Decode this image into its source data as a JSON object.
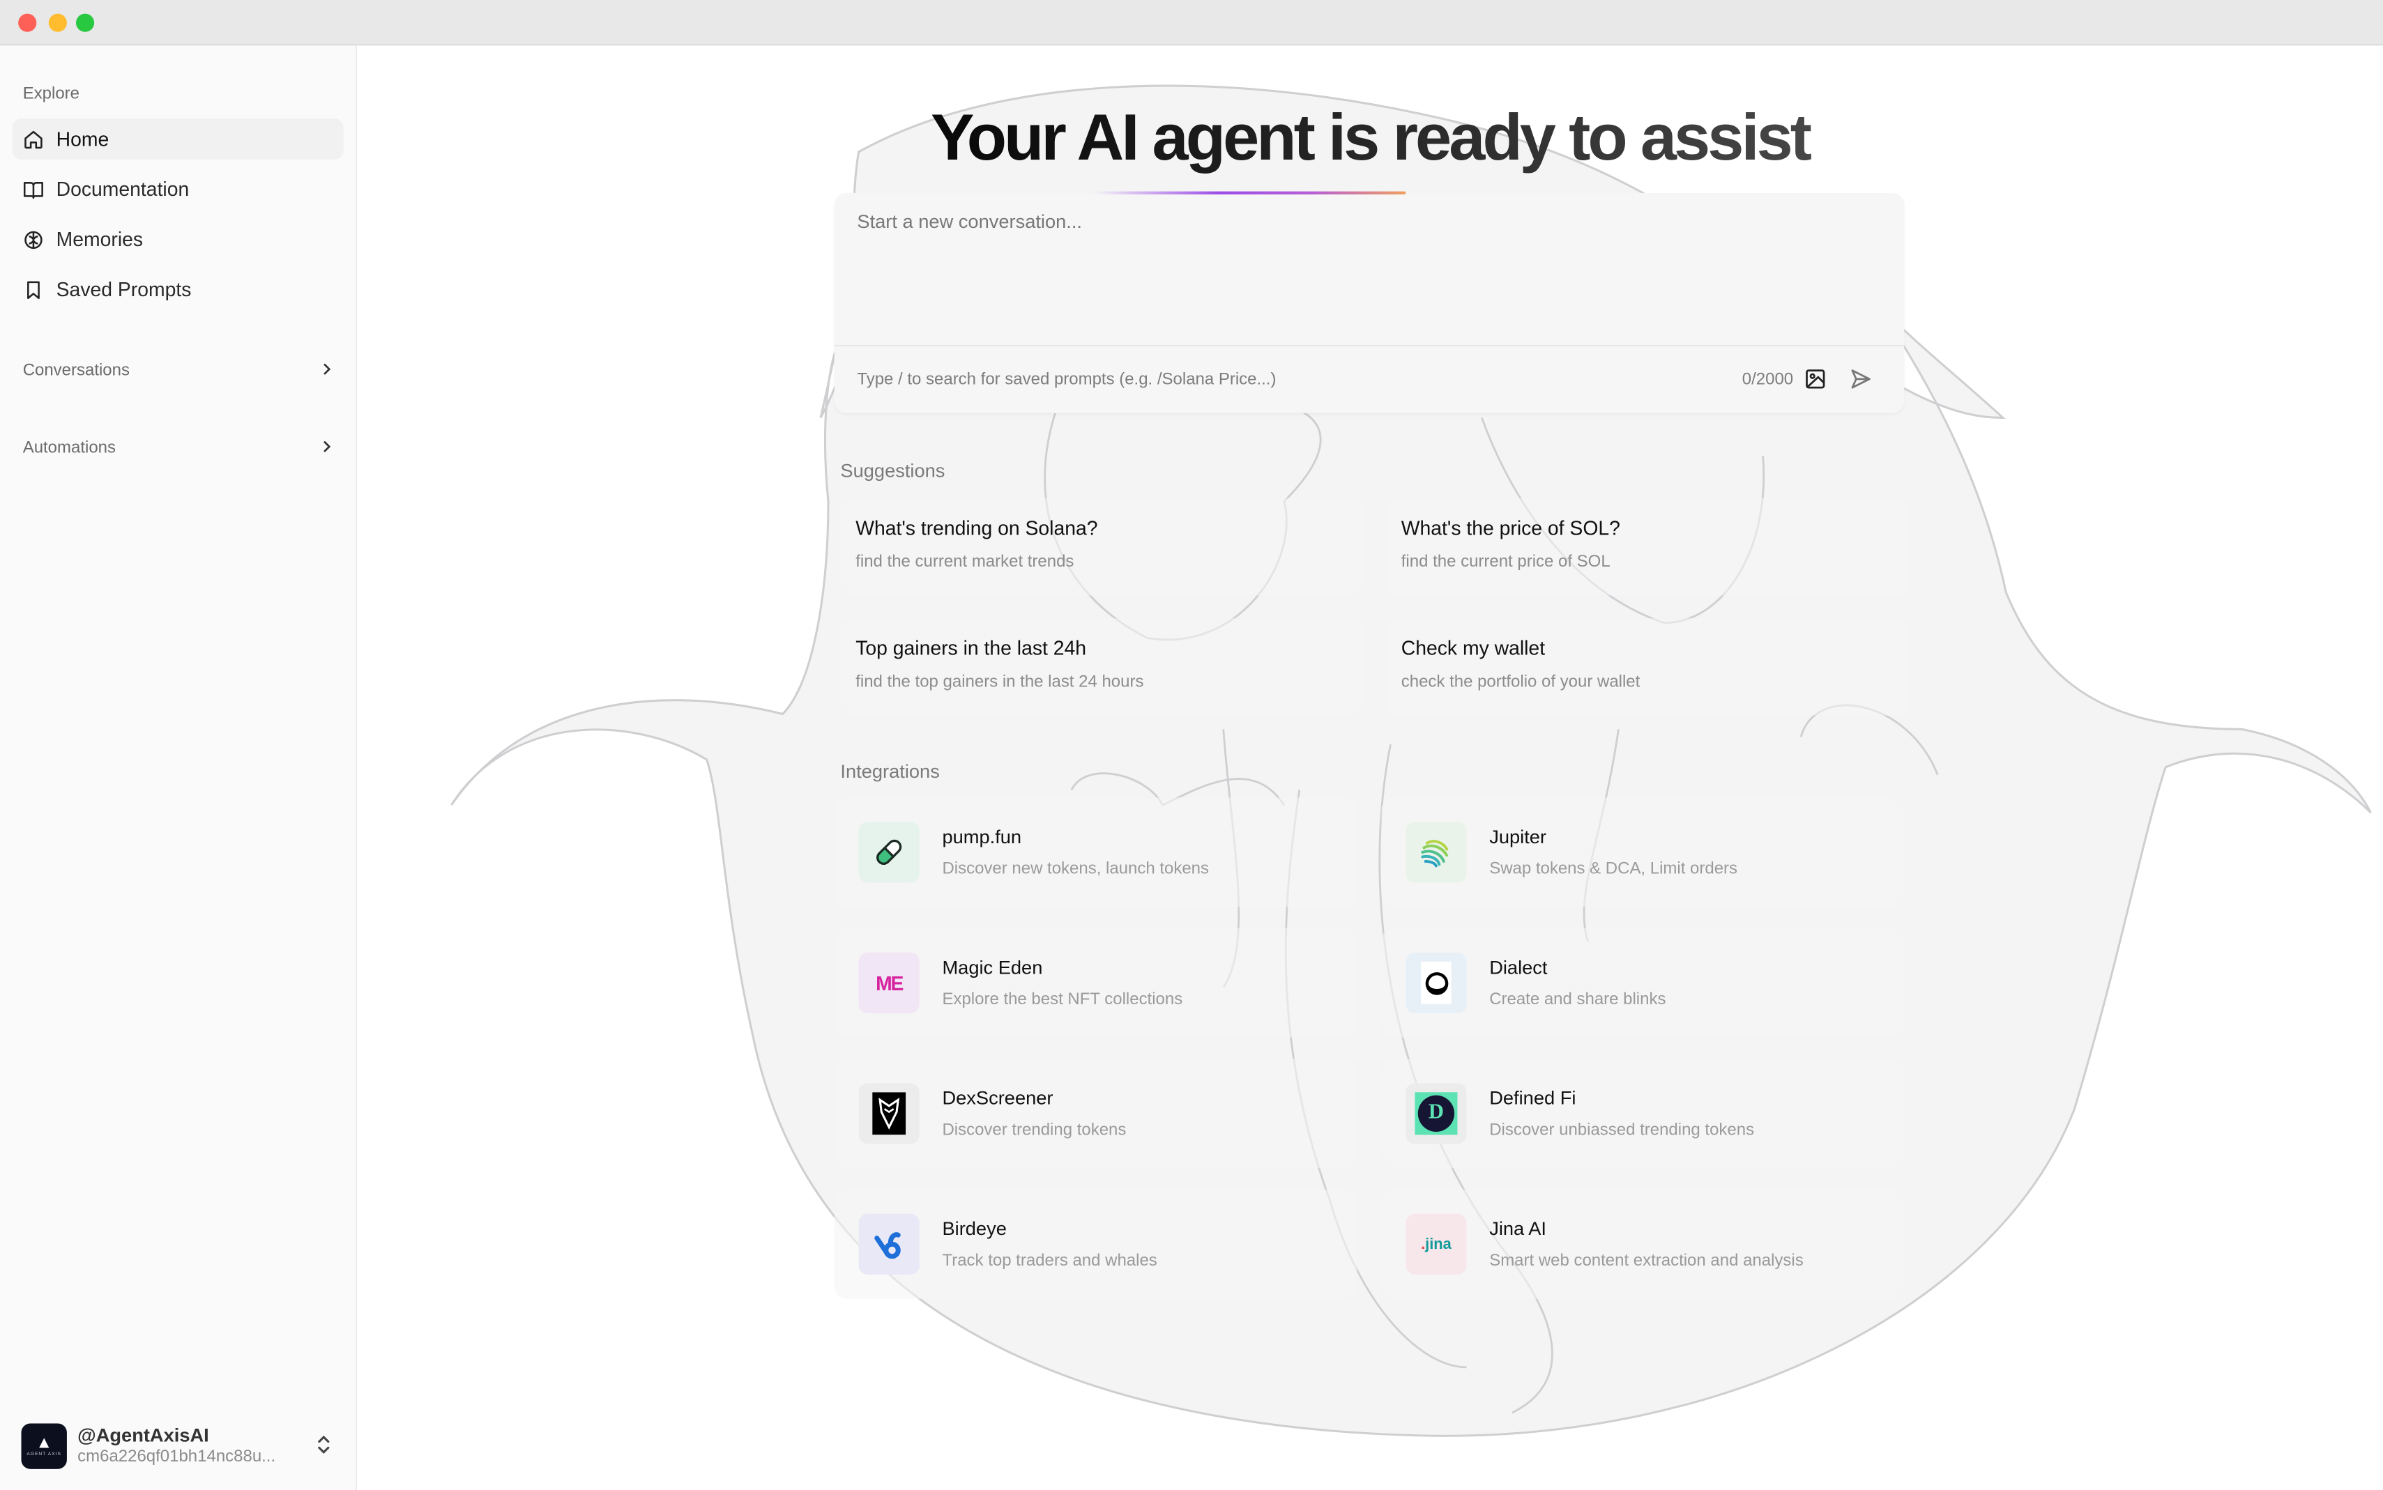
{
  "window": {
    "controls": [
      "close",
      "minimize",
      "maximize"
    ]
  },
  "sidebar": {
    "explore_label": "Explore",
    "items": [
      {
        "label": "Home",
        "icon": "home-icon",
        "active": true
      },
      {
        "label": "Documentation",
        "icon": "book-icon",
        "active": false
      },
      {
        "label": "Memories",
        "icon": "brain-icon",
        "active": false
      },
      {
        "label": "Saved Prompts",
        "icon": "bookmark-icon",
        "active": false
      }
    ],
    "groups": [
      {
        "label": "Conversations",
        "icon": "chevron-right-icon"
      },
      {
        "label": "Automations",
        "icon": "chevron-right-icon"
      }
    ],
    "user": {
      "handle": "@AgentAxisAI",
      "id": "cm6a226qf01bh14nc88u...",
      "avatar_text": "AGENT AXIS"
    }
  },
  "main": {
    "title": "Your AI agent is ready to assist",
    "composer": {
      "placeholder": "Start a new conversation...",
      "hint": "Type / to search for saved prompts (e.g. /Solana Price...)",
      "char_count": "0/2000",
      "max_chars": 2000,
      "image_icon": "image-icon",
      "send_icon": "send-icon"
    },
    "suggestions_label": "Suggestions",
    "suggestions": [
      {
        "title": "What's trending on Solana?",
        "desc": "find the current market trends"
      },
      {
        "title": "What's the price of SOL?",
        "desc": "find the current price of SOL"
      },
      {
        "title": "Top gainers in the last 24h",
        "desc": "find the top gainers in the last 24 hours"
      },
      {
        "title": "Check my wallet",
        "desc": "check the portfolio of your wallet"
      }
    ],
    "integrations_label": "Integrations",
    "integrations": [
      {
        "name": "pump.fun",
        "desc": "Discover new tokens, launch tokens",
        "icon": "pill-icon",
        "tint": "#e6f3ec"
      },
      {
        "name": "Jupiter",
        "desc": "Swap tokens & DCA, Limit orders",
        "icon": "jupiter-icon",
        "tint": "#e9f3ea"
      },
      {
        "name": "Magic Eden",
        "desc": "Explore the best NFT collections",
        "icon": "magic-eden-icon",
        "tint": "#f1e6f5"
      },
      {
        "name": "Dialect",
        "desc": "Create and share blinks",
        "icon": "dialect-icon",
        "tint": "#e8f0f7"
      },
      {
        "name": "DexScreener",
        "desc": "Discover trending tokens",
        "icon": "dexscreener-icon",
        "tint": "#ececec"
      },
      {
        "name": "Defined Fi",
        "desc": "Discover unbiassed trending tokens",
        "icon": "defined-fi-icon",
        "tint": "#ececec"
      },
      {
        "name": "Birdeye",
        "desc": "Track top traders and whales",
        "icon": "birdeye-icon",
        "tint": "#e8e8f6"
      },
      {
        "name": "Jina AI",
        "desc": "Smart web content extraction and analysis",
        "icon": "jina-icon",
        "tint": "#f7e7ea"
      }
    ]
  },
  "colors": {
    "accent_gradient": [
      "#9c4ee6",
      "#f0a060"
    ],
    "magic_eden": "#d6239f",
    "birdeye": "#1f6fd8",
    "defined_fi_bg": "#5de3b3"
  }
}
